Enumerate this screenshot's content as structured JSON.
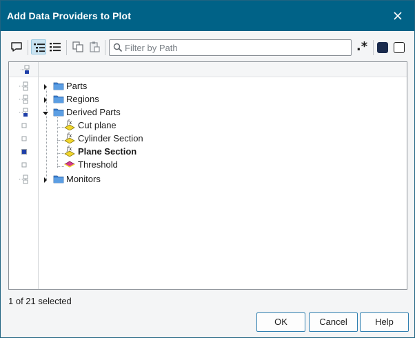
{
  "window": {
    "title": "Add Data Providers to Plot"
  },
  "toolbar": {
    "filter_placeholder": "Filter by Path",
    "regex_label": ".*"
  },
  "tree": {
    "items": [
      {
        "label": "Parts",
        "expandable": true,
        "expanded": false,
        "icon": "folder-icon",
        "level": 0,
        "checkbox": "partial"
      },
      {
        "label": "Regions",
        "expandable": true,
        "expanded": false,
        "icon": "folder-icon",
        "level": 0,
        "checkbox": "partial"
      },
      {
        "label": "Derived Parts",
        "expandable": true,
        "expanded": true,
        "icon": "folder-icon",
        "level": 0,
        "checkbox": "partial-selected"
      },
      {
        "label": "Cut plane",
        "expandable": false,
        "icon": "fx-plane-icon",
        "level": 1,
        "checkbox": "unchecked"
      },
      {
        "label": "Cylinder Section",
        "expandable": false,
        "icon": "fx-plane-icon",
        "level": 1,
        "checkbox": "unchecked"
      },
      {
        "label": "Plane Section",
        "expandable": false,
        "icon": "fx-plane-icon",
        "level": 1,
        "checkbox": "checked",
        "bold": true
      },
      {
        "label": "Threshold",
        "expandable": false,
        "icon": "threshold-icon",
        "level": 1,
        "checkbox": "unchecked"
      },
      {
        "label": "Monitors",
        "expandable": true,
        "expanded": false,
        "icon": "folder-icon",
        "level": 0,
        "checkbox": "partial"
      }
    ]
  },
  "status": {
    "text": "1 of 21 selected"
  },
  "buttons": {
    "ok": "OK",
    "cancel": "Cancel",
    "help": "Help"
  },
  "colors": {
    "titlebar": "#006287",
    "accent": "#2f7fb0",
    "checked": "#1f3fa8"
  }
}
